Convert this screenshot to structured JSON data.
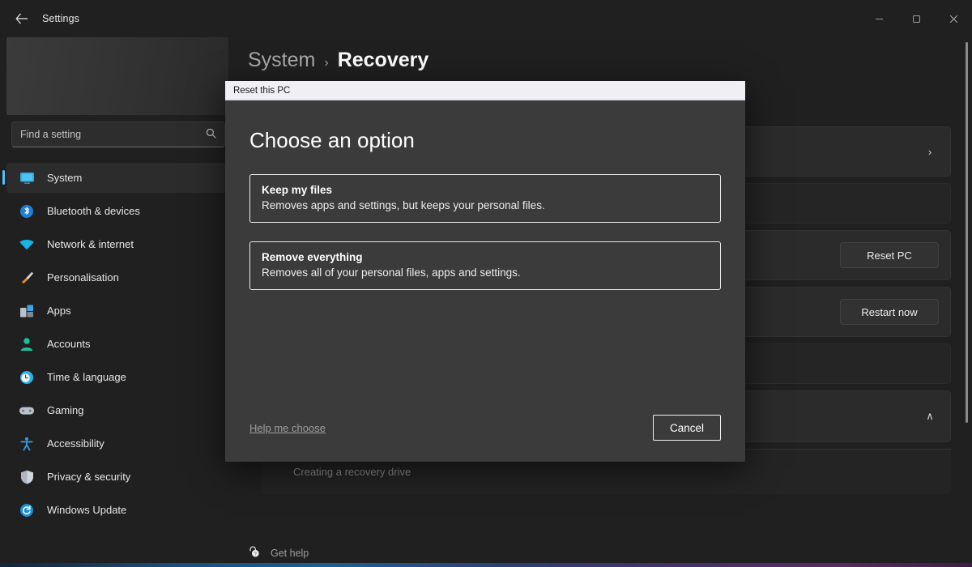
{
  "window": {
    "app_title": "Settings",
    "back_icon": "arrow-left-icon",
    "controls": {
      "minimize": "minimize-icon",
      "maximize": "maximize-icon",
      "close": "close-icon"
    }
  },
  "sidebar": {
    "search": {
      "placeholder": "Find a setting",
      "icon": "search-icon"
    },
    "items": [
      {
        "label": "System",
        "icon": "display-icon",
        "selected": true
      },
      {
        "label": "Bluetooth & devices",
        "icon": "bluetooth-icon",
        "selected": false
      },
      {
        "label": "Network & internet",
        "icon": "wifi-icon",
        "selected": false
      },
      {
        "label": "Personalisation",
        "icon": "paintbrush-icon",
        "selected": false
      },
      {
        "label": "Apps",
        "icon": "apps-icon",
        "selected": false
      },
      {
        "label": "Accounts",
        "icon": "person-icon",
        "selected": false
      },
      {
        "label": "Time & language",
        "icon": "clock-icon",
        "selected": false
      },
      {
        "label": "Gaming",
        "icon": "gamepad-icon",
        "selected": false
      },
      {
        "label": "Accessibility",
        "icon": "accessibility-icon",
        "selected": false
      },
      {
        "label": "Privacy & security",
        "icon": "shield-icon",
        "selected": false
      },
      {
        "label": "Windows Update",
        "icon": "update-icon",
        "selected": false
      }
    ]
  },
  "content": {
    "breadcrumb": {
      "parent": "System",
      "separator": "›",
      "current": "Recovery"
    },
    "rows": [
      {
        "action": "chevron-right-icon",
        "action_label": "›"
      },
      {
        "action": "none",
        "action_label": ""
      },
      {
        "action": "button",
        "action_label": "Reset PC"
      },
      {
        "action": "button",
        "action_label": "Restart now"
      },
      {
        "action": "none",
        "action_label": ""
      },
      {
        "action": "chevron-up-icon",
        "action_label": "∧"
      }
    ],
    "sub_row_label": "Creating a recovery drive",
    "get_help": {
      "label": "Get help",
      "icon": "help-icon"
    }
  },
  "dialog": {
    "title": "Reset this PC",
    "heading": "Choose an option",
    "options": [
      {
        "title": "Keep my files",
        "desc": "Removes apps and settings, but keeps your personal files."
      },
      {
        "title": "Remove everything",
        "desc": "Removes all of your personal files, apps and settings."
      }
    ],
    "help_link": "Help me choose",
    "cancel_label": "Cancel"
  },
  "colors": {
    "accent": "#4cc2ff",
    "window_bg": "#202020",
    "dialog_bg": "#3b3b3b",
    "dialog_titlebar": "#f0f0f4"
  }
}
